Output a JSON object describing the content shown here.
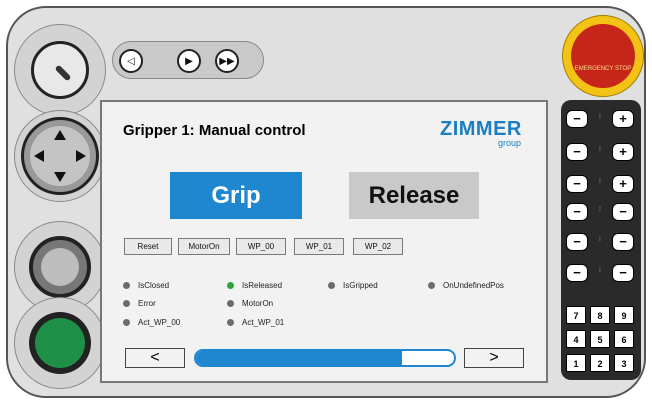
{
  "screen": {
    "title": "Gripper 1: Manual control",
    "logo": {
      "brand": "ZIMMER",
      "sub": "group"
    },
    "main_buttons": {
      "grip": "Grip",
      "release": "Release"
    },
    "small_buttons": [
      "Reset",
      "MotorOn",
      "WP_00",
      "WP_01",
      "WP_02"
    ],
    "status_items": [
      {
        "label": "IsClosed",
        "active": false
      },
      {
        "label": "IsReleased",
        "active": true
      },
      {
        "label": "IsGripped",
        "active": false
      },
      {
        "label": "OnUndefinedPos",
        "active": false
      },
      {
        "label": "Error",
        "active": false
      },
      {
        "label": "MotorOn",
        "active": false
      },
      {
        "label": "Act_WP_00",
        "active": false
      },
      {
        "label": "Act_WP_01",
        "active": false
      }
    ],
    "nav": {
      "prev": "<",
      "next": ">",
      "progress": 0.8
    },
    "colors": {
      "accent": "#1f87d0",
      "led_on": "#2ea23d",
      "led_off": "#6b6b6b"
    }
  },
  "pendant": {
    "media_buttons": [
      "◁",
      "▶",
      "▶▶"
    ],
    "estop_label": "EMERGENCY STOP",
    "jog_keys": [
      {
        "minus": "−",
        "plus": "+"
      },
      {
        "minus": "−",
        "plus": "+"
      },
      {
        "minus": "−",
        "plus": "+"
      },
      {
        "minus": "−",
        "plus": "−"
      },
      {
        "minus": "−",
        "plus": "−"
      },
      {
        "minus": "−",
        "plus": "−"
      }
    ],
    "numpad": [
      "7",
      "8",
      "9",
      "4",
      "5",
      "6",
      "1",
      "2",
      "3"
    ]
  }
}
